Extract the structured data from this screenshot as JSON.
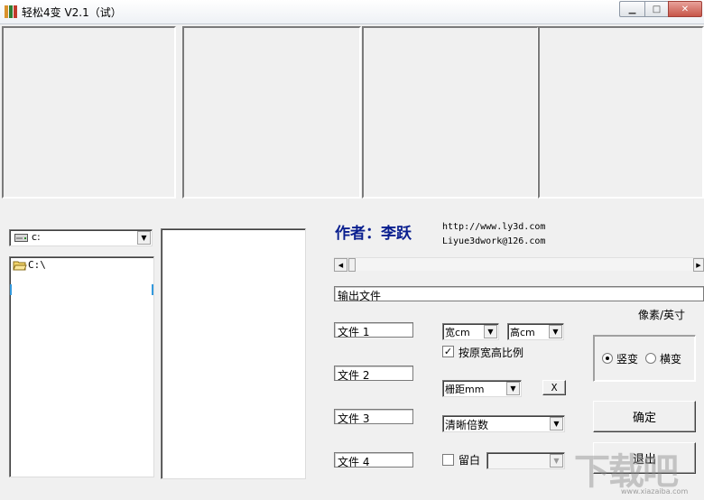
{
  "window": {
    "title": "轻松4变 V2.1（试）",
    "minimize_glyph": "▁",
    "maximize_glyph": "□",
    "close_glyph": "✕"
  },
  "drive_combo": {
    "value": "c:",
    "icon": "drive-icon"
  },
  "folder_tree": {
    "items": [
      "C:\\"
    ],
    "icon": "folder-open-icon"
  },
  "author": {
    "label": "作者：李跃",
    "url": "http://www.ly3d.com",
    "email": "Liyue3dwork@126.com"
  },
  "output_field": {
    "value": "输出文件"
  },
  "unit_label": "像素/英寸",
  "files": [
    "文件 1",
    "文件 2",
    "文件 3",
    "文件 4"
  ],
  "width_select": {
    "value": "宽cm"
  },
  "height_select": {
    "value": "高cm"
  },
  "keep_ratio": {
    "label": "按原宽高比例",
    "checked": true,
    "check_glyph": "✓"
  },
  "spacing_select": {
    "value": "栅距mm"
  },
  "x_button": {
    "label": "X"
  },
  "clarity_select": {
    "value": "清晰倍数"
  },
  "margin": {
    "label": "留白",
    "checked": false,
    "select_value": ""
  },
  "orientation": {
    "options": [
      {
        "label": "竖变",
        "selected": true
      },
      {
        "label": "横变",
        "selected": false
      }
    ]
  },
  "confirm_button": {
    "label": "确定"
  },
  "exit_button": {
    "label": "退出"
  },
  "watermark": {
    "text": "下载吧",
    "url": "www.xiazaiba.com"
  },
  "colors": {
    "author_blue": "#0a1f8f",
    "window_bg": "#f0f0f0"
  }
}
